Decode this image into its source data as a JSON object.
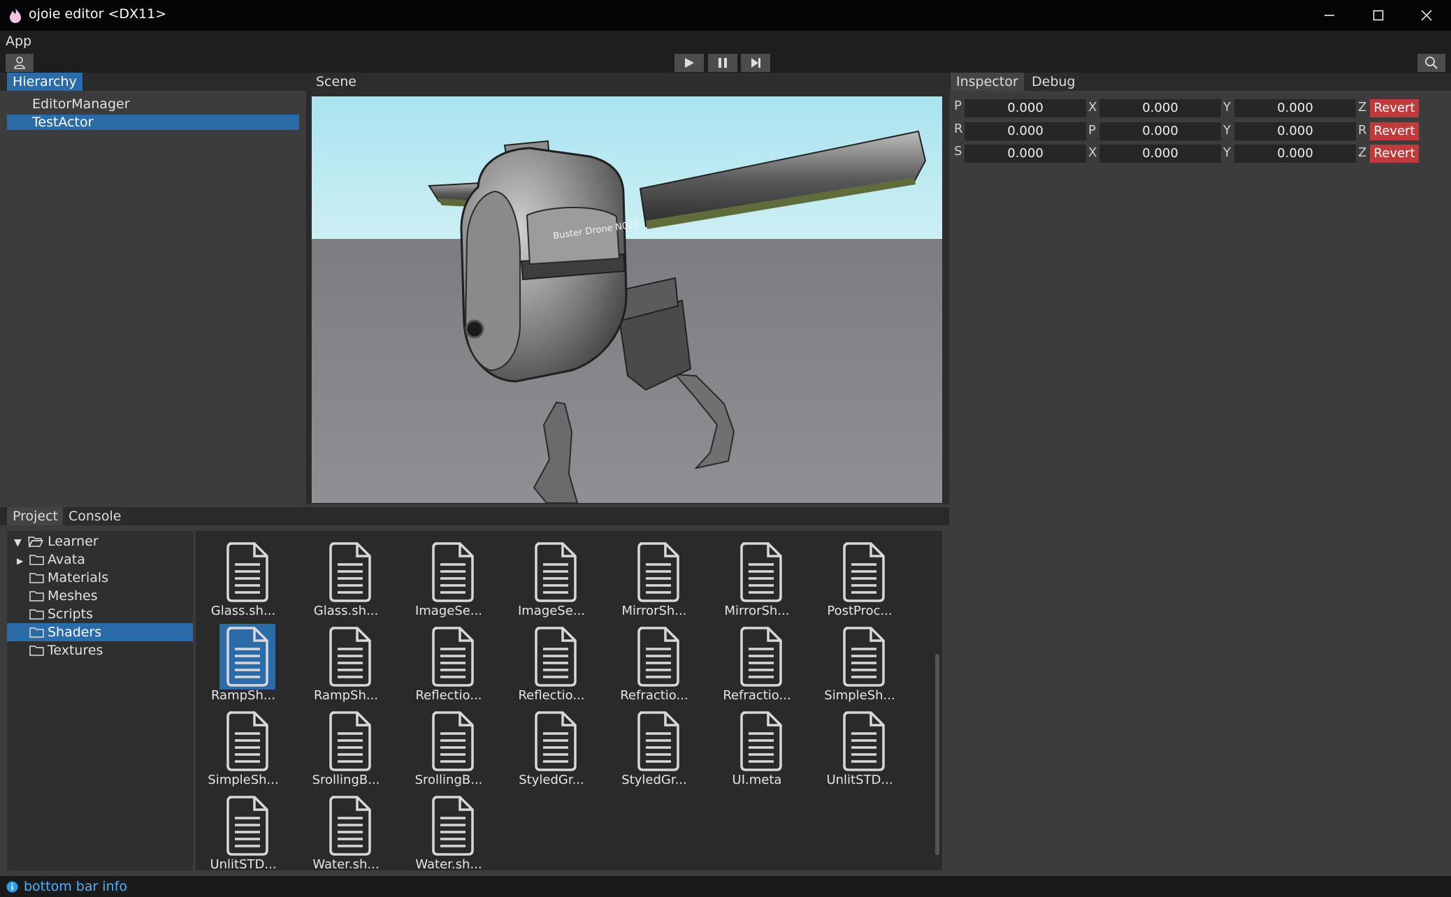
{
  "window": {
    "title": "ojoie editor <DX11>"
  },
  "menu": {
    "app_label": "App"
  },
  "hierarchy": {
    "tab_label": "Hierarchy",
    "items": [
      {
        "label": "EditorManager",
        "selected": false
      },
      {
        "label": "TestActor",
        "selected": true
      }
    ]
  },
  "scene": {
    "tab_label": "Scene",
    "drone_decal": "Buster Drone N027"
  },
  "inspector": {
    "tabs": [
      "Inspector",
      "Debug"
    ],
    "rows": [
      {
        "label": "P",
        "fields": [
          {
            "value": "0.000",
            "axis": "X"
          },
          {
            "value": "0.000",
            "axis": "Y"
          },
          {
            "value": "0.000",
            "axis": "Z"
          }
        ],
        "button": "Revert"
      },
      {
        "label": "R",
        "fields": [
          {
            "value": "0.000",
            "axis": "P"
          },
          {
            "value": "0.000",
            "axis": "Y"
          },
          {
            "value": "0.000",
            "axis": "R"
          }
        ],
        "button": "Revert"
      },
      {
        "label": "S",
        "fields": [
          {
            "value": "0.000",
            "axis": "X"
          },
          {
            "value": "0.000",
            "axis": "Y"
          },
          {
            "value": "0.000",
            "axis": "Z"
          }
        ],
        "button": "Revert"
      }
    ]
  },
  "project": {
    "tabs": [
      "Project",
      "Console"
    ],
    "tree": {
      "root": "Learner",
      "folders": [
        {
          "label": "Avata",
          "expandable": true,
          "selected": false
        },
        {
          "label": "Materials",
          "expandable": false,
          "selected": false
        },
        {
          "label": "Meshes",
          "expandable": false,
          "selected": false
        },
        {
          "label": "Scripts",
          "expandable": false,
          "selected": false
        },
        {
          "label": "Shaders",
          "expandable": false,
          "selected": true
        },
        {
          "label": "Textures",
          "expandable": false,
          "selected": false
        }
      ]
    },
    "files": [
      "Glass.sh...",
      "Glass.sh...",
      "ImageSe...",
      "ImageSe...",
      "MirrorSh...",
      "MirrorSh...",
      "PostProc...",
      "RampSh...",
      "RampSh...",
      "Reflectio...",
      "Reflectio...",
      "Refractio...",
      "Refractio...",
      "SimpleSh...",
      "SimpleSh...",
      "SrollingB...",
      "SrollingB...",
      "StyledGr...",
      "StyledGr...",
      "UI.meta",
      "UnlitSTD...",
      "UnlitSTD...",
      "Water.sh...",
      "Water.sh..."
    ],
    "selected_file_index": 7
  },
  "statusbar": {
    "text": "bottom bar info"
  },
  "colors": {
    "accent": "#2b6ba8",
    "revert": "#c0393b",
    "sky": "#b9e9f2",
    "ground": "#8a898c"
  }
}
